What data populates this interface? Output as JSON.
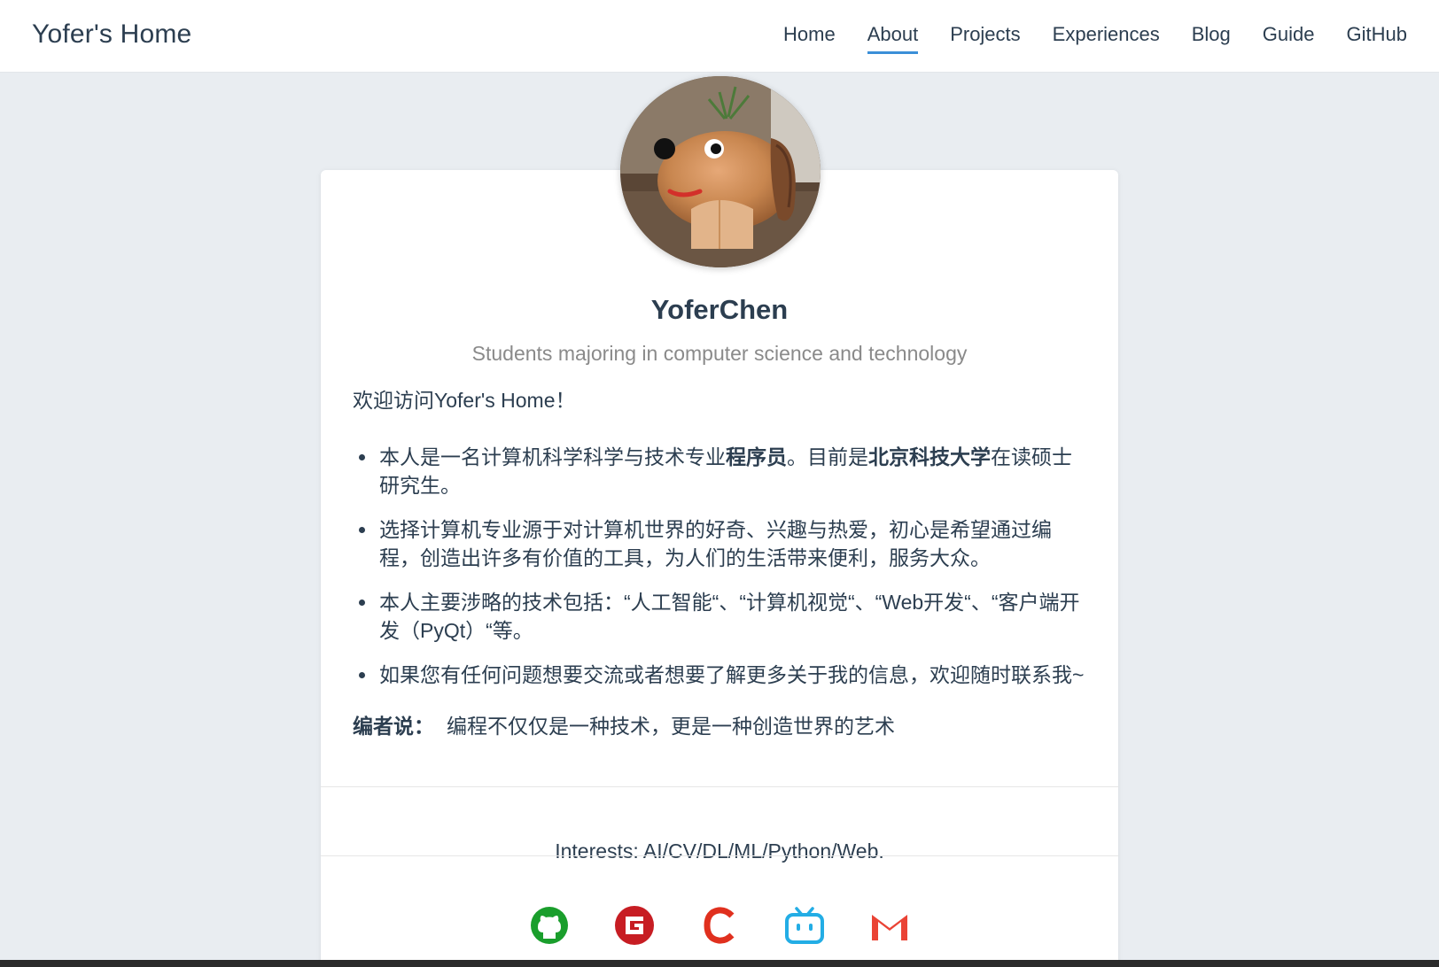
{
  "nav": {
    "brand": "Yofer's Home",
    "links": [
      {
        "label": "Home",
        "active": false
      },
      {
        "label": "About",
        "active": true
      },
      {
        "label": "Projects",
        "active": false
      },
      {
        "label": "Experiences",
        "active": false
      },
      {
        "label": "Blog",
        "active": false
      },
      {
        "label": "Guide",
        "active": false
      },
      {
        "label": "GitHub",
        "active": false
      }
    ]
  },
  "profile": {
    "name": "YoferChen",
    "subtitle": "Students majoring in computer science and technology",
    "welcome": "欢迎访问Yofer's Home！",
    "items": [
      {
        "p1": "本人是一名计算机科学科学与技术专业",
        "b1": "程序员",
        "p2": "。目前是",
        "b2": "北京科技大学",
        "p3": "在读硕士研究生。"
      },
      {
        "p1": "选择计算机专业源于对计算机世界的好奇、兴趣与热爱，初心是希望通过编程，创造出许多有价值的工具，为人们的生活带来便利，服务大众。"
      },
      {
        "p1": "本人主要涉略的技术包括：“人工智能“、“计算机视觉“、“Web开发“、“客户端开发（PyQt）“等。"
      },
      {
        "p1": "如果您有任何问题想要交流或者想要了解更多关于我的信息，欢迎随时联系我~"
      }
    ],
    "editor_label": "编者说：",
    "editor_text": "编程不仅仅是一种技术，更是一种创造世界的艺术",
    "interests": "Interests: AI/CV/DL/ML/Python/Web."
  },
  "social": [
    {
      "name": "github-icon",
      "color": "#1a9e2c"
    },
    {
      "name": "gitee-icon",
      "color": "#c71d23"
    },
    {
      "name": "csdn-icon",
      "color": "#e0301e"
    },
    {
      "name": "bilibili-icon",
      "color": "#23ade5"
    },
    {
      "name": "gmail-icon",
      "color": "#ea4335"
    }
  ],
  "colors": {
    "accent": "#3b8fd8",
    "text": "#2c3e50",
    "muted": "#8a8a8a",
    "background": "#e9edf1"
  }
}
